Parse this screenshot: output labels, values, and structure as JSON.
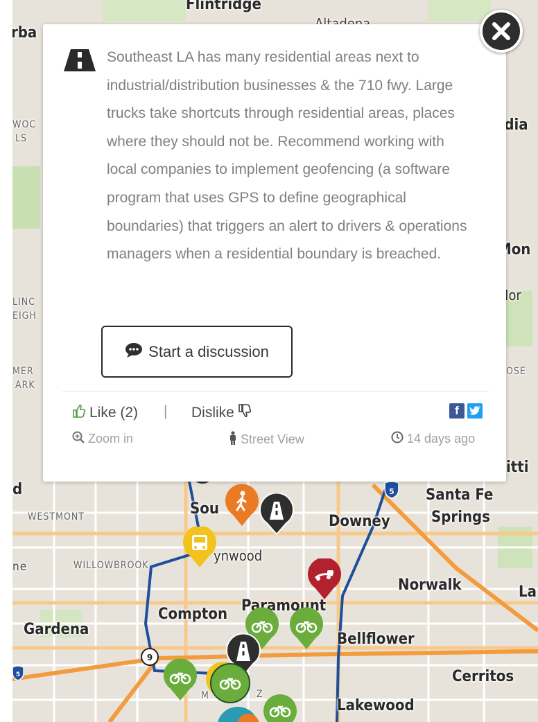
{
  "map": {
    "places": {
      "flintridge": "Flintridge",
      "altadena": "Altadena",
      "urba": "rba",
      "woo": "WOC",
      "ls": "LS",
      "adia": "adia",
      "mon": "Mon",
      "mor": "Mor",
      "linc": "LINC",
      "eigh": "EIGH",
      "mer": "MER",
      "ark": "ARK",
      "ose": "OSE",
      "itti": "itti",
      "d": "d",
      "westmont": "WESTMONT",
      "south": "Sou",
      "downey": "Downey",
      "santa_fe": "Santa Fe",
      "springs": "Springs",
      "ne": "ne",
      "willowbrook": "WILLOWBROOK",
      "lynwood": "ynwood",
      "norwalk": "Norwalk",
      "la": "La",
      "compton": "Compton",
      "paramount": "Paramount",
      "gardena": "Gardena",
      "bellflower": "Bellflower",
      "cerritos": "Cerritos",
      "lakewood": "Lakewood",
      "z": "Z",
      "m": "M"
    },
    "shields": {
      "i5": "5",
      "sr9": "9",
      "i105": "5"
    },
    "markers": [
      "pedestrian-marker",
      "road-marker",
      "bus-marker",
      "truck-marker",
      "bike-marker",
      "road-marker",
      "bike-marker"
    ]
  },
  "popup": {
    "category_icon": "road-icon",
    "comment": "Southeast LA has many residential areas next to industrial/distribution businesses & the 710 fwy. Large trucks take shortcuts through residential areas, places where they should not be. Recommend working with local companies to implement geofencing (a software program that uses GPS to define geographical boundaries) that triggers an alert to drivers & operations managers when a residential boundary is breached.",
    "discussion_button": "Start a discussion",
    "like_label": "Like (2)",
    "separator": "|",
    "dislike_label": "Dislike",
    "zoom_label": "Zoom in",
    "street_view_label": "Street View",
    "time_ago": "14 days ago",
    "share_icons": [
      "facebook-icon",
      "twitter-icon"
    ],
    "colors": {
      "road": "#2e2e2e",
      "bike": "#6aad3d",
      "pedestrian": "#ea7a23",
      "bus": "#f2c21d",
      "truck": "#b2222e",
      "facebook": "#3b5998",
      "twitter": "#1da1f2",
      "freeway": "#f3a54a",
      "route": "#1e4f9c"
    }
  }
}
